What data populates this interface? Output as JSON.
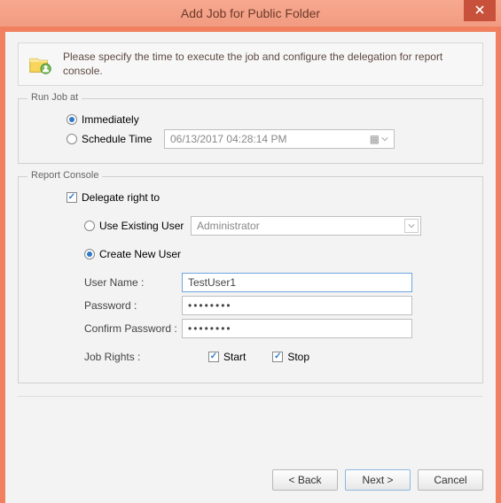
{
  "window": {
    "title": "Add Job for Public Folder"
  },
  "intro": {
    "text": "Please specify the time to execute the job and configure the delegation for report console."
  },
  "run_job": {
    "legend": "Run Job at",
    "immediately_label": "Immediately",
    "schedule_label": "Schedule Time",
    "schedule_value": "06/13/2017 04:28:14 PM",
    "selected": "immediately"
  },
  "report_console": {
    "legend": "Report Console",
    "delegate_checkbox_label": "Delegate right to",
    "delegate_checked": true,
    "use_existing_label": "Use Existing User",
    "existing_user_value": "Administrator",
    "create_new_label": "Create New User",
    "user_mode": "create",
    "fields": {
      "username_label": "User Name :",
      "username_value": "TestUser1",
      "password_label": "Password :",
      "password_value": "••••••••",
      "confirm_label": "Confirm Password :",
      "confirm_value": "••••••••",
      "job_rights_label": "Job Rights :",
      "start_label": "Start",
      "start_checked": true,
      "stop_label": "Stop",
      "stop_checked": true
    }
  },
  "buttons": {
    "back": "< Back",
    "next": "Next >",
    "cancel": "Cancel"
  }
}
